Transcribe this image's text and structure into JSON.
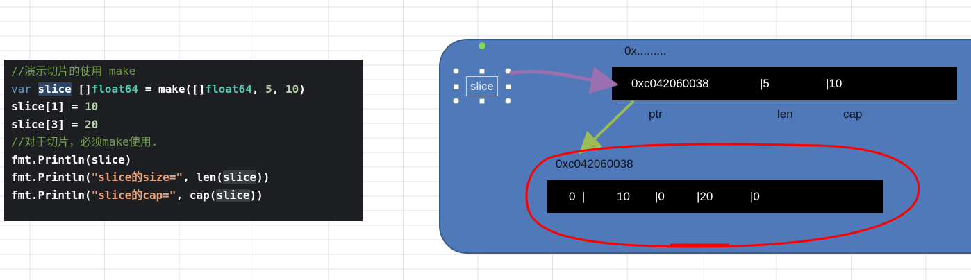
{
  "code": {
    "line1_comment": "//演示切片的使用 make",
    "line2_var": "var",
    "line2_name": "slice",
    "line2_rest_a": " []",
    "line2_type": "float64",
    "line2_rest_b": " = make([]",
    "line2_type2": "float64",
    "line2_rest_c": ", ",
    "line2_num1": "5",
    "line2_rest_d": ", ",
    "line2_num2": "10",
    "line2_rest_e": ")",
    "line3_a": "slice[1] = ",
    "line3_num": "10",
    "line4_a": "slice[3] = ",
    "line4_num": "20",
    "line5_comment": "//对于切片，必须make使用.",
    "line6": "fmt.Println(slice)",
    "line7_a": "fmt.Println(",
    "line7_str": "\"slice的size=\"",
    "line7_b": ", len(",
    "line7_hl": "slice",
    "line7_c": "))",
    "line8_a": "fmt.Println(",
    "line8_str": "\"slice的cap=\"",
    "line8_b": ", cap(",
    "line8_hl": "slice",
    "line8_c": "))"
  },
  "diagram": {
    "addr_placeholder": "0x.........",
    "slice_label": "slice",
    "header_bar": {
      "ptr_value": "0xc042060038",
      "len_value": "|5",
      "cap_value": "|10"
    },
    "header_labels": {
      "ptr": "ptr",
      "len": "len",
      "cap": "cap"
    },
    "array_address": "0xc042060038",
    "array_cells": [
      "0  |",
      "10",
      "|0",
      "|20",
      "|0"
    ]
  },
  "colors": {
    "container_fill": "#4f79b8",
    "arrow_purple": "#9b6fb0",
    "arrow_green": "#9bbb59",
    "ellipse_red": "#ff0000",
    "code_bg": "#1e1f22"
  }
}
